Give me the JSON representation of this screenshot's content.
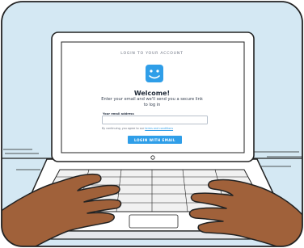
{
  "window": {
    "background": "#d4e8f3"
  },
  "login": {
    "header": "LOGIN TO YOUR ACCOUNT",
    "logo_icon": "smiley-face-icon",
    "title": "Welcome!",
    "subtitle_line1": "Enter your email and we'll send you a secure link",
    "subtitle_line2": "to log in",
    "email_label": "Your email address",
    "email_value": "",
    "terms_prefix": "By continuing, you agree to our ",
    "terms_link": "terms and conditions",
    "button_label": "LOGIN WITH EMAIL",
    "accent_color": "#2f9ee8"
  }
}
